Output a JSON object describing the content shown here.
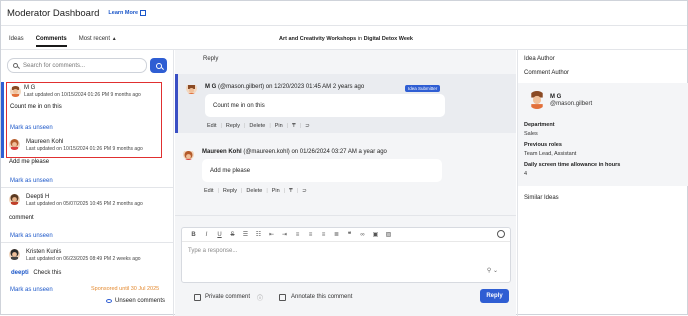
{
  "header": {
    "title": "Moderator Dashboard",
    "learn_more": "Learn More"
  },
  "tabs": [
    {
      "label": "Ideas"
    },
    {
      "label": "Comments"
    },
    {
      "label": "Most recent"
    }
  ],
  "crumb": {
    "title": "Art and Creativity Workshops",
    "in": "in",
    "group": "Digital Detox Week"
  },
  "search": {
    "placeholder": "Search for comments..."
  },
  "list": [
    {
      "name": "M G",
      "updated": "Last updated on 10/15/2024 01:26 PM 9 months ago",
      "body": "Count me in on this",
      "mark": "Mark as unseen"
    },
    {
      "name": "Maureen Kohl",
      "updated": "Last updated on 10/15/2024 01:26 PM 9 months ago",
      "body": "Add me please",
      "mark": "Mark as unseen"
    },
    {
      "name": "Deepti H",
      "updated": "Last updated on 05/07/2025 10:45 PM 2 months ago",
      "body": "comment",
      "mark": "Mark as unseen"
    },
    {
      "name": "Kristen Kunis",
      "updated": "Last updated on 06/23/2025 08:49 PM 2 weeks ago",
      "mention": "deepti",
      "body": "Check this",
      "mark": "Mark as unseen"
    }
  ],
  "sponsored": "Sponsored until 30 Jul 2025",
  "unseen": "Unseen comments",
  "reply_header": "Reply",
  "comments": [
    {
      "name": "M G",
      "handle": "(@mason.gilbert)",
      "on": "on 12/20/2023 01:45 AM 2 years ago",
      "badge": "Idea Submitter",
      "body": "Count me in on this",
      "actions": [
        "Edit",
        "Reply",
        "Delete",
        "Pin"
      ]
    },
    {
      "name": "Maureen Kohl",
      "handle": "(@maureen.kohl)",
      "on": "on 01/26/2024 03:27 AM a year ago",
      "body": "Add me please",
      "actions": [
        "Edit",
        "Reply",
        "Delete",
        "Pin"
      ]
    }
  ],
  "editor": {
    "placeholder": "Type a response...",
    "private": "Private comment",
    "annotate": "Annotate this comment",
    "reply": "Reply"
  },
  "right": {
    "idea_author": "Idea Author",
    "comment_author": "Comment Author",
    "author_name": "M G",
    "author_handle": "@mason.gilbert",
    "dept_label": "Department",
    "dept": "Sales",
    "roles_label": "Previous roles",
    "roles": "Team Lead, Assistant",
    "screen_label": "Daily screen time allowance in hours",
    "screen": "4",
    "similar": "Similar Ideas"
  },
  "colors": {
    "accent": "#2f5ed3",
    "selection": "#e03030",
    "sponsored": "#e48a30"
  }
}
